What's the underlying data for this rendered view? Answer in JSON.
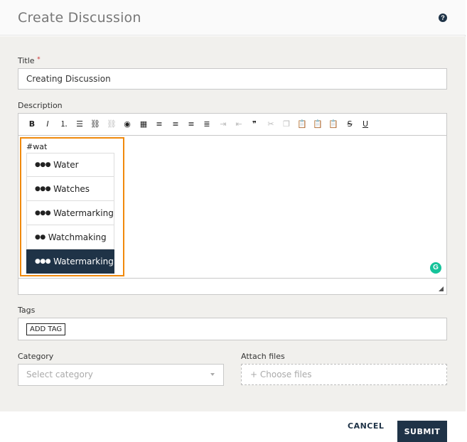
{
  "dialog": {
    "title": "Create Discussion",
    "help_icon": "question-circle-icon",
    "help_glyph": "?"
  },
  "form": {
    "title_label": "Title",
    "title_required_mark": "*",
    "title_value": "Creating Discussion",
    "description_label": "Description",
    "toolbar": [
      {
        "name": "bold-icon",
        "glyph": "B",
        "enabled": true
      },
      {
        "name": "italic-icon",
        "glyph": "I",
        "enabled": true
      },
      {
        "name": "numbered-list-icon",
        "glyph": "⒈",
        "enabled": true
      },
      {
        "name": "bulleted-list-icon",
        "glyph": "☰",
        "enabled": true
      },
      {
        "name": "link-icon",
        "glyph": "⛓",
        "enabled": true
      },
      {
        "name": "unlink-icon",
        "glyph": "⛓",
        "enabled": false
      },
      {
        "name": "image-icon",
        "glyph": "◉",
        "enabled": true
      },
      {
        "name": "table-icon",
        "glyph": "▦",
        "enabled": true
      },
      {
        "name": "align-left-icon",
        "glyph": "≡",
        "enabled": true
      },
      {
        "name": "align-center-icon",
        "glyph": "≡",
        "enabled": true
      },
      {
        "name": "align-right-icon",
        "glyph": "≡",
        "enabled": true
      },
      {
        "name": "justify-icon",
        "glyph": "≣",
        "enabled": true
      },
      {
        "name": "indent-icon",
        "glyph": "⇥",
        "enabled": false
      },
      {
        "name": "outdent-icon",
        "glyph": "⇤",
        "enabled": false
      },
      {
        "name": "blockquote-icon",
        "glyph": "❞",
        "enabled": true
      },
      {
        "name": "cut-icon",
        "glyph": "✂",
        "enabled": false
      },
      {
        "name": "copy-icon",
        "glyph": "❐",
        "enabled": false
      },
      {
        "name": "paste-icon",
        "glyph": "📋",
        "enabled": true
      },
      {
        "name": "paste-text-icon",
        "glyph": "📋",
        "enabled": true
      },
      {
        "name": "paste-word-icon",
        "glyph": "📋",
        "enabled": true
      },
      {
        "name": "strikethrough-icon",
        "glyph": "S",
        "enabled": true
      },
      {
        "name": "underline-icon",
        "glyph": "U",
        "enabled": true
      }
    ],
    "typed_text": "#wat",
    "mention_suggestions": [
      {
        "label": "Water",
        "dots": "●●●",
        "selected": false
      },
      {
        "label": "Watches",
        "dots": "●●●",
        "selected": false
      },
      {
        "label": "Watermarking",
        "dots": "●●●",
        "selected": false
      },
      {
        "label": "Watchmaking",
        "dots": "●●",
        "selected": false
      },
      {
        "label": "Watermarking",
        "dots": "●●●",
        "selected": true
      }
    ],
    "grammarly_icon": "grammarly-icon",
    "grammarly_glyph": "G",
    "tags_label": "Tags",
    "add_tag_label": "ADD TAG",
    "category_label": "Category",
    "category_placeholder": "Select category",
    "attach_label": "Attach files",
    "attach_placeholder": "+ Choose files"
  },
  "actions": {
    "cancel_label": "CANCEL",
    "submit_label": "SUBMIT"
  },
  "colors": {
    "primary": "#1f3347",
    "highlight_border": "#f0890c",
    "grammarly": "#15c39a"
  }
}
